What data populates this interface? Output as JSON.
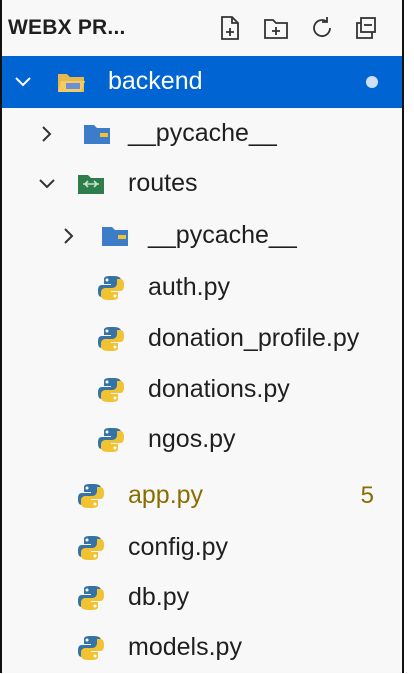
{
  "explorer": {
    "title": "WEBX PR...",
    "actions": [
      {
        "name": "new-file-icon"
      },
      {
        "name": "new-folder-icon"
      },
      {
        "name": "refresh-icon"
      },
      {
        "name": "collapse-all-icon"
      }
    ]
  },
  "tree": {
    "backend": "backend",
    "pycache1": "__pycache__",
    "routes": "routes",
    "pycache2": "__pycache__",
    "auth": "auth.py",
    "donation_profile": "donation_profile.py",
    "donations": "donations.py",
    "ngos": "ngos.py",
    "app": "app.py",
    "app_problems": "5",
    "config": "config.py",
    "db": "db.py",
    "models": "models.py"
  },
  "colors": {
    "selection": "#0064d2",
    "warning_text": "#8a6d00",
    "python_blue": "#3572A5",
    "python_yellow": "#F1C232"
  }
}
